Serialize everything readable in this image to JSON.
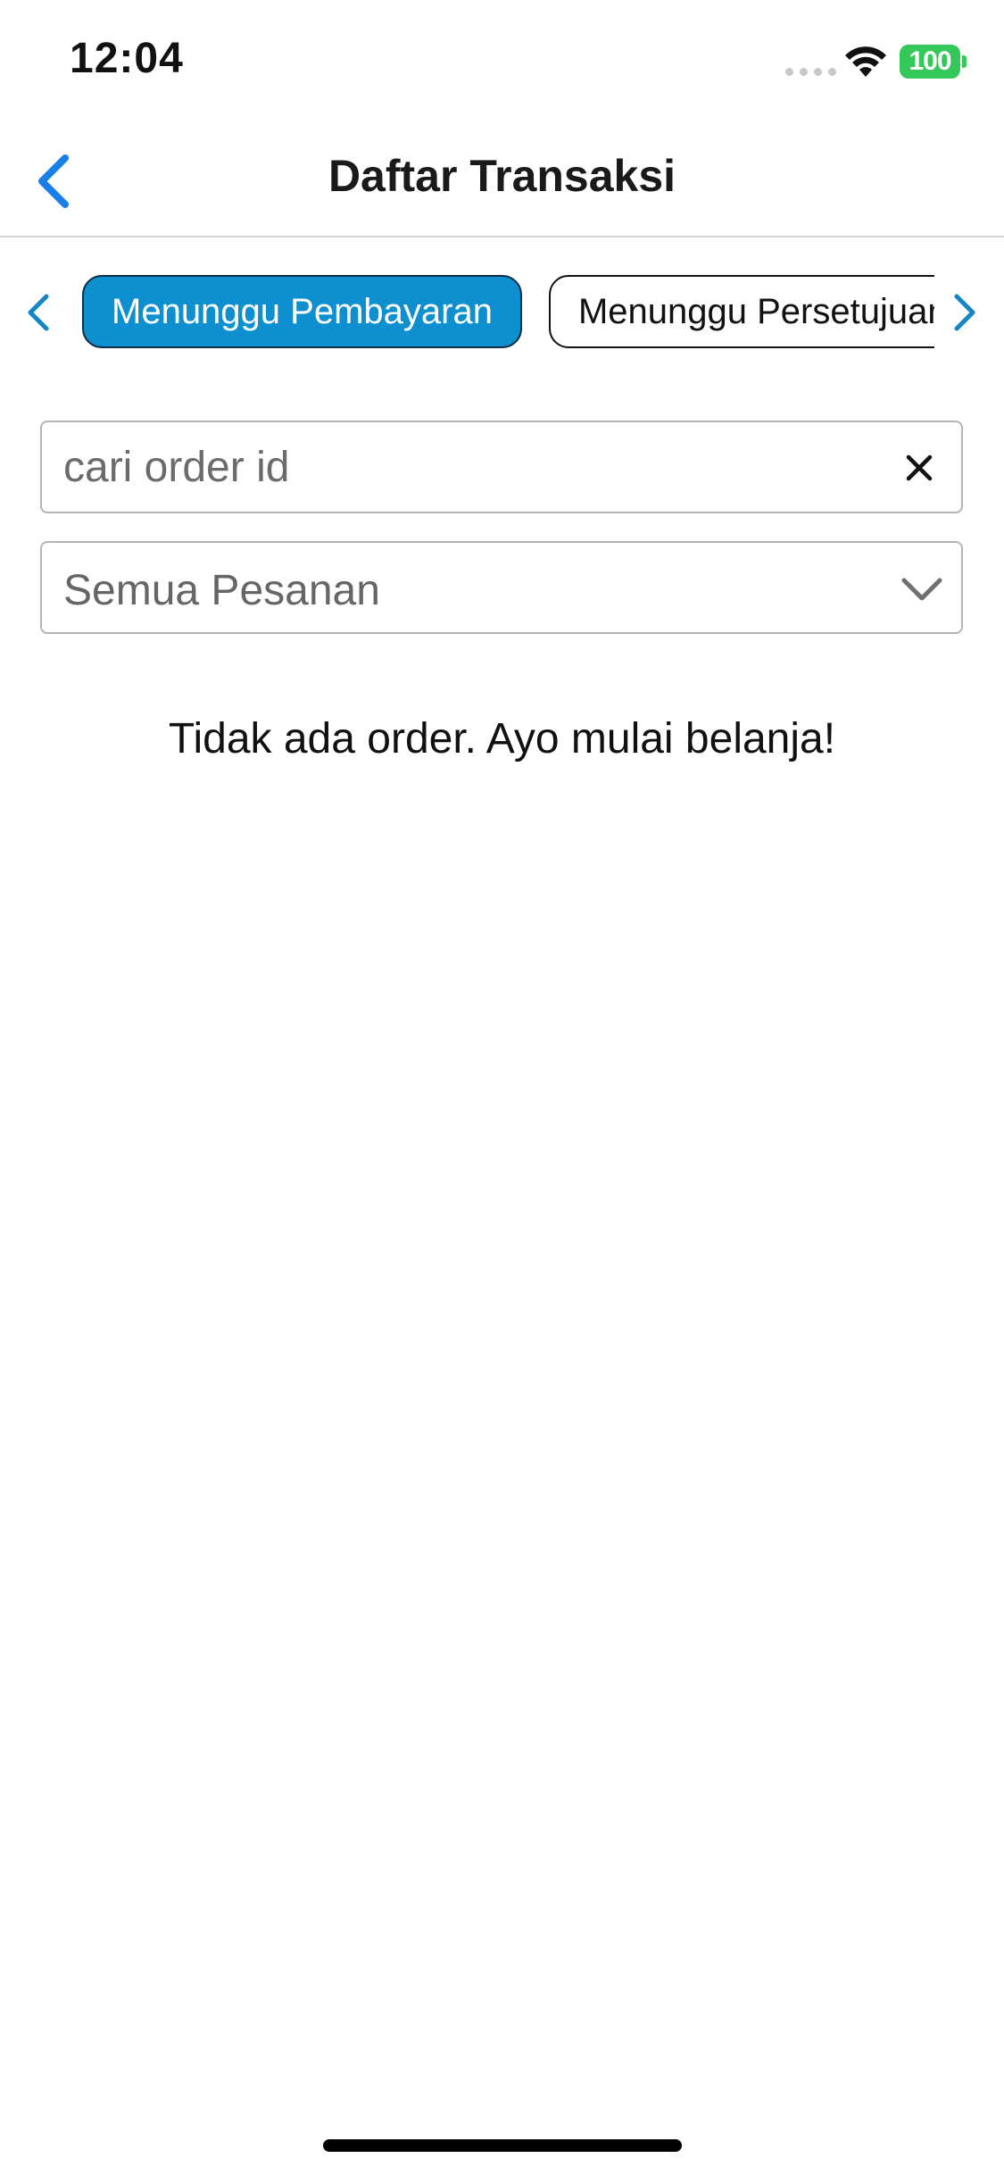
{
  "status_bar": {
    "time": "12:04",
    "battery": "100",
    "battery_color": "#34c759"
  },
  "nav": {
    "title": "Daftar Transaksi",
    "back_icon": "chevron-left-icon",
    "accent": "#1a7ee8"
  },
  "tabs": {
    "prev_icon": "chevron-left-icon",
    "next_icon": "chevron-right-icon",
    "items": [
      {
        "label": "Menunggu Pembayaran",
        "active": true
      },
      {
        "label": "Menunggu Persetujuan",
        "active": false
      }
    ],
    "active_color": "#0e8fcf"
  },
  "search": {
    "placeholder": "cari order id",
    "value": "",
    "clear_icon": "close-icon"
  },
  "filter": {
    "selected": "Semua Pesanan",
    "icon": "chevron-down-icon"
  },
  "empty_state": {
    "message": "Tidak ada order. Ayo mulai belanja!"
  }
}
